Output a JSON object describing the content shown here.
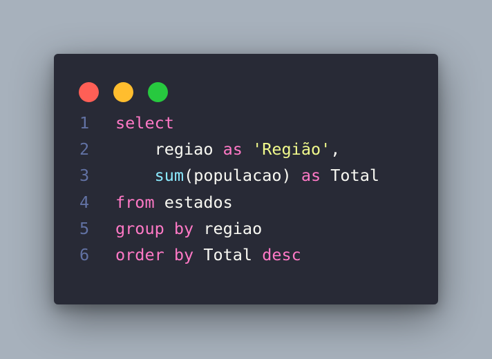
{
  "window": {
    "controls": [
      {
        "name": "close",
        "color": "#ff5f56"
      },
      {
        "name": "minimize",
        "color": "#ffbd2e"
      },
      {
        "name": "maximize",
        "color": "#27c93f"
      }
    ]
  },
  "code": {
    "language": "sql",
    "lines": [
      {
        "number": "1",
        "tokens": [
          {
            "text": "select",
            "type": "keyword"
          }
        ]
      },
      {
        "number": "2",
        "tokens": [
          {
            "text": "    regiao ",
            "type": "plain"
          },
          {
            "text": "as",
            "type": "keyword"
          },
          {
            "text": " ",
            "type": "plain"
          },
          {
            "text": "'Região'",
            "type": "string"
          },
          {
            "text": ",",
            "type": "plain"
          }
        ]
      },
      {
        "number": "3",
        "tokens": [
          {
            "text": "    ",
            "type": "plain"
          },
          {
            "text": "sum",
            "type": "func"
          },
          {
            "text": "(populacao) ",
            "type": "plain"
          },
          {
            "text": "as",
            "type": "keyword"
          },
          {
            "text": " Total",
            "type": "plain"
          }
        ]
      },
      {
        "number": "4",
        "tokens": [
          {
            "text": "from",
            "type": "keyword"
          },
          {
            "text": " estados",
            "type": "plain"
          }
        ]
      },
      {
        "number": "5",
        "tokens": [
          {
            "text": "group by",
            "type": "keyword"
          },
          {
            "text": " regiao",
            "type": "plain"
          }
        ]
      },
      {
        "number": "6",
        "tokens": [
          {
            "text": "order by",
            "type": "keyword"
          },
          {
            "text": " Total ",
            "type": "plain"
          },
          {
            "text": "desc",
            "type": "keyword"
          }
        ]
      }
    ]
  }
}
